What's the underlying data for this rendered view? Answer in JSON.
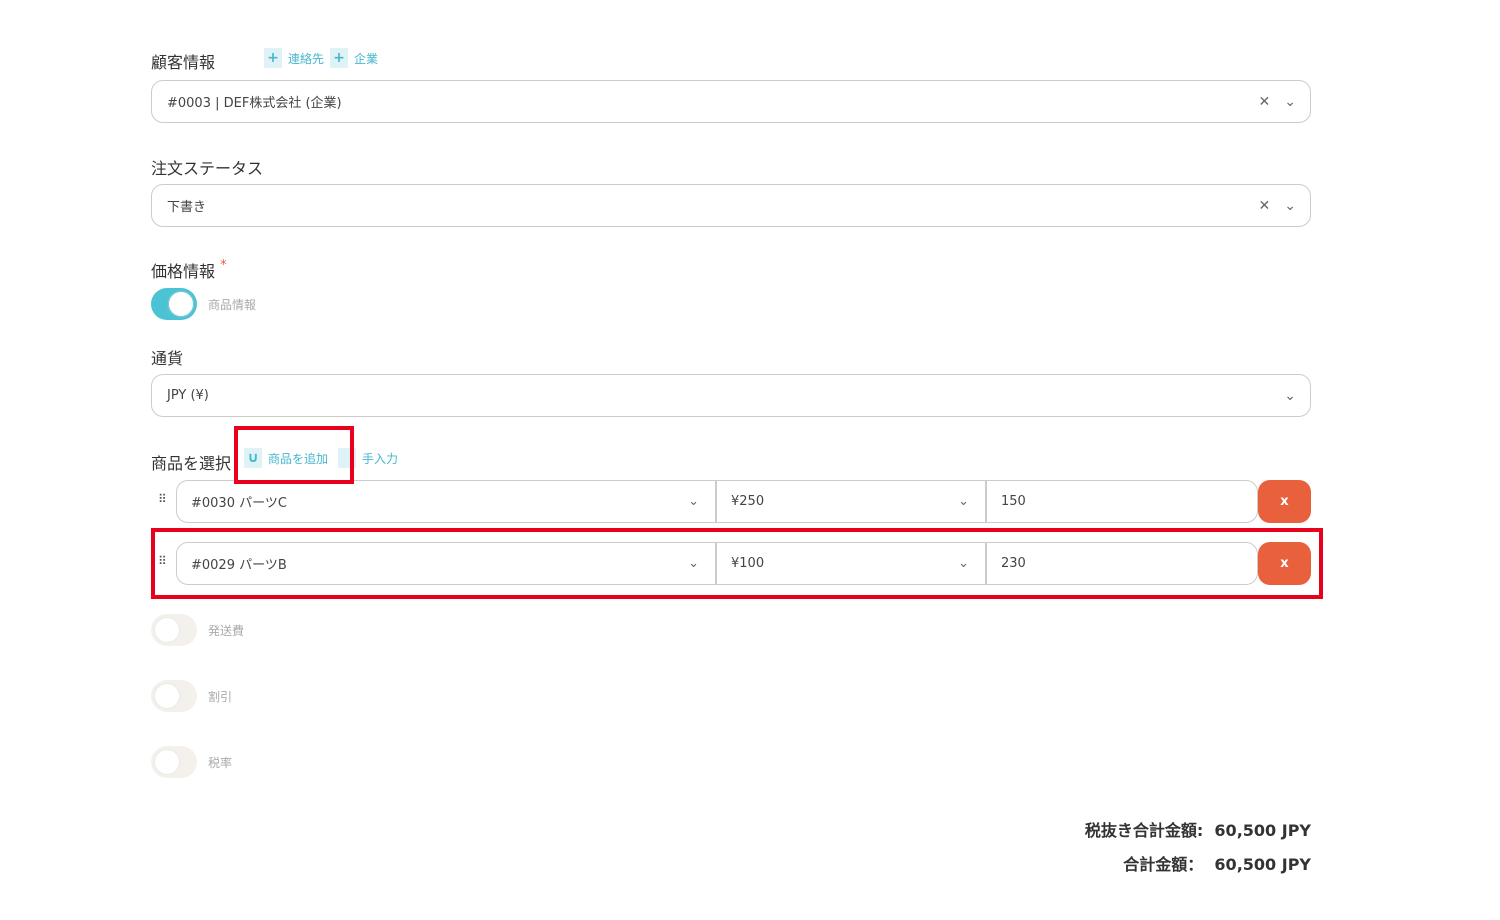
{
  "customer": {
    "label": "顧客情報",
    "add_contact": "連絡先",
    "add_company": "企業",
    "value": "#0003 | DEF株式会社 (企業)"
  },
  "status": {
    "label": "注文ステータス",
    "value": "下書き"
  },
  "price_info": {
    "label": "価格情報",
    "required": "*",
    "toggle_label": "商品情報",
    "toggle_on": true
  },
  "currency": {
    "label": "通貨",
    "value": "JPY (¥)"
  },
  "products": {
    "label": "商品を選択",
    "add_product": "商品を追加",
    "manual": "手入力",
    "rows": [
      {
        "product": "#0030 パーツC",
        "price": "¥250",
        "qty": "150",
        "delete": "x"
      },
      {
        "product": "#0029 パーツB",
        "price": "¥100",
        "qty": "230",
        "delete": "x"
      }
    ]
  },
  "options": [
    {
      "label": "発送費",
      "on": false
    },
    {
      "label": "割引",
      "on": false
    },
    {
      "label": "税率",
      "on": false
    }
  ],
  "totals": {
    "subtotal_label": "税抜き合計金額:",
    "subtotal": "60,500 JPY",
    "total_label": "合計金額：",
    "total": "60,500 JPY"
  },
  "colors": {
    "accent": "#4cc3d4",
    "delete": "#e8603c",
    "highlight": "#e8001c"
  }
}
